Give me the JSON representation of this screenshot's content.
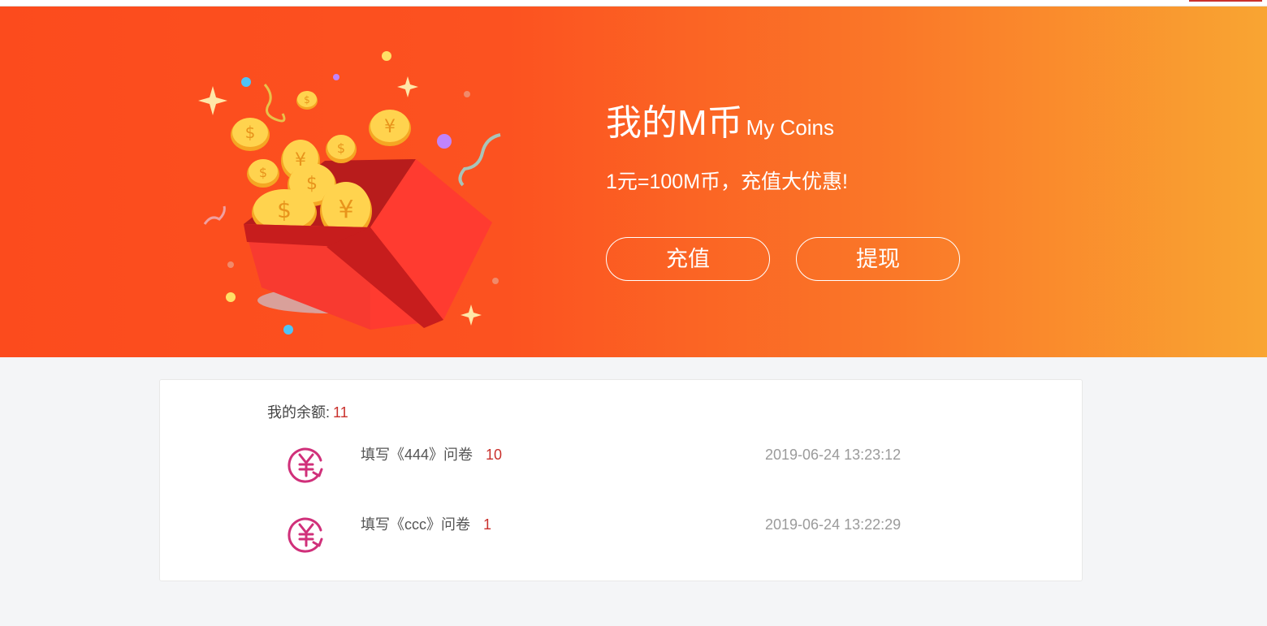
{
  "banner": {
    "title": "我的M币",
    "title_en": "My Coins",
    "subtitle": "1元=100M币，充值大优惠!",
    "recharge_label": "充值",
    "withdraw_label": "提现",
    "illustration_icon": "gift-box-coins-icon"
  },
  "account": {
    "balance_label": "我的余额:",
    "balance_value": "11"
  },
  "records": [
    {
      "icon": "yuan-exchange-icon",
      "description": "填写《444》问卷",
      "amount": "10",
      "time": "2019-06-24 13:23:12"
    },
    {
      "icon": "yuan-exchange-icon",
      "description": "填写《ccc》问卷",
      "amount": "1",
      "time": "2019-06-24 13:22:29"
    }
  ],
  "colors": {
    "banner_start": "#fc4b1d",
    "banner_end": "#f9a532",
    "accent_red": "#c9302c",
    "icon_magenta": "#d0307a"
  }
}
